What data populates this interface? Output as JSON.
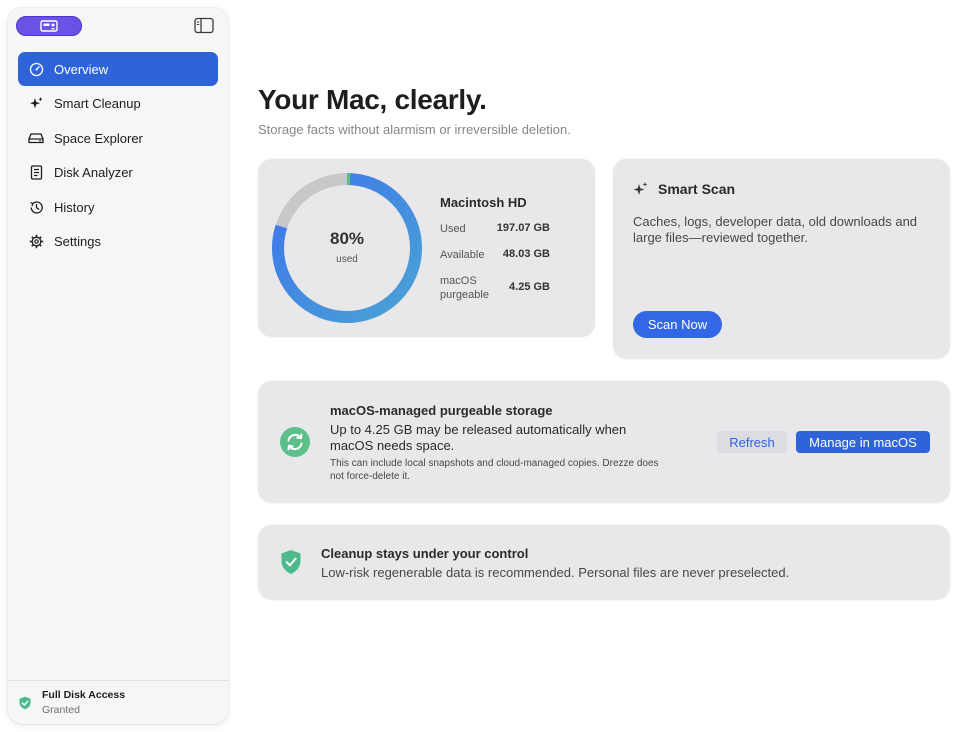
{
  "sidebar": {
    "items": [
      {
        "label": "Overview",
        "icon": "gauge-icon",
        "active": true
      },
      {
        "label": "Smart Cleanup",
        "icon": "sparkles-icon"
      },
      {
        "label": "Space Explorer",
        "icon": "drive-icon"
      },
      {
        "label": "Disk Analyzer",
        "icon": "document-icon"
      },
      {
        "label": "History",
        "icon": "clock-arrow-icon"
      },
      {
        "label": "Settings",
        "icon": "gear-icon"
      }
    ],
    "footer": {
      "title": "Full Disk Access",
      "status": "Granted"
    }
  },
  "main": {
    "title": "Your Mac, clearly.",
    "subtitle": "Storage facts without alarmism or irreversible deletion."
  },
  "disk": {
    "name": "Macintosh HD",
    "percent_used": 80,
    "percent_label": "80%",
    "center_label": "used",
    "used_label": "Used",
    "used_value": "197.07 GB",
    "available_label": "Available",
    "available_value": "48.03 GB",
    "purgeable_label_line1": "macOS",
    "purgeable_label_line2": "purgeable",
    "purgeable_value": "4.25 GB"
  },
  "scan": {
    "title": "Smart Scan",
    "description": "Caches, logs, developer data, old downloads and large files—reviewed together.",
    "button": "Scan Now"
  },
  "purgeable": {
    "title": "macOS-managed purgeable storage",
    "description": "Up to 4.25 GB may be released automatically when macOS needs space.",
    "note": "This can include local snapshots and cloud-managed copies. Drezze does not force-delete it.",
    "refresh_label": "Refresh",
    "manage_label": "Manage in macOS"
  },
  "control": {
    "title": "Cleanup stays under your control",
    "description": "Low-risk regenerable data is recommended. Personal files are never preselected."
  },
  "colors": {
    "accent": "#2f63d8",
    "app_button": "#6a52e6",
    "ring_blue": "#3d74ec",
    "ring_teal": "#4aa3d4",
    "ring_green": "#5cc08b",
    "ring_track": "#c8c8ca",
    "shield_green": "#4cba8c"
  }
}
